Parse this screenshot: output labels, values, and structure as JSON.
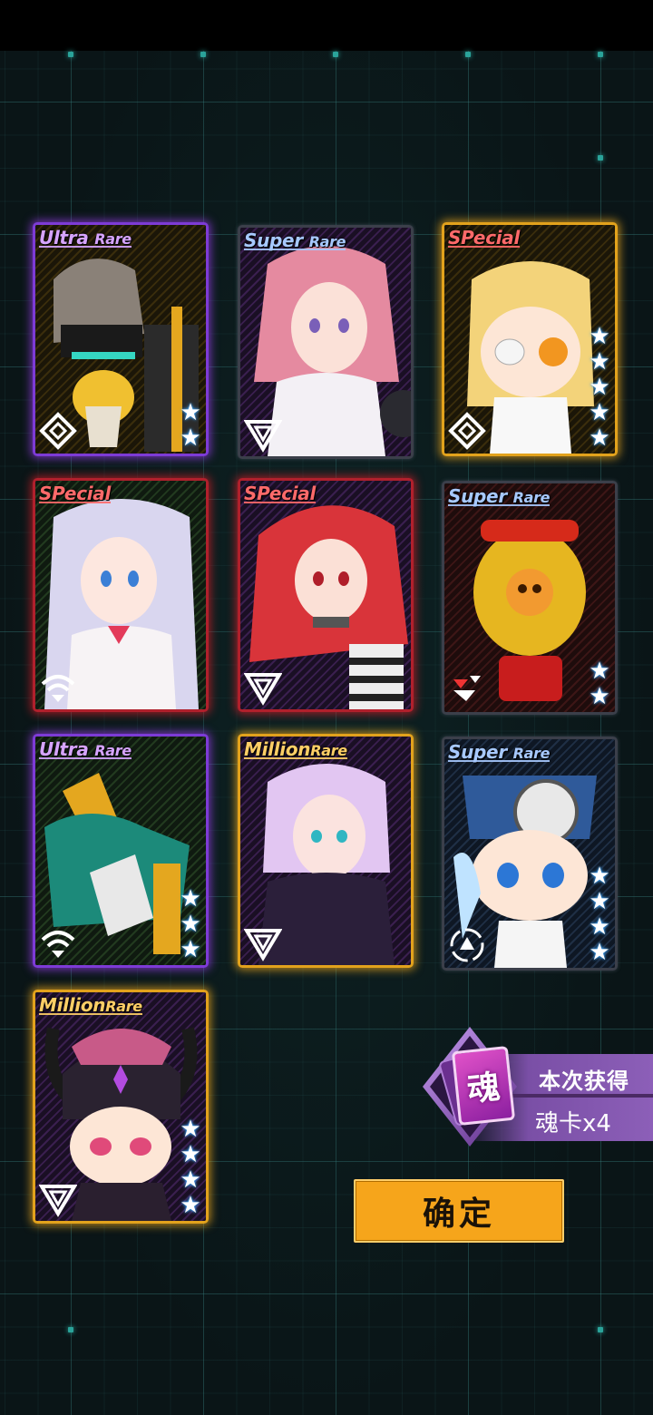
{
  "cards": [
    {
      "rarity_main": "Ultra",
      "rarity_sub": "Rare",
      "tier": "ur",
      "stars": 2,
      "element": "diamond-element-icon",
      "portrait": "mech-operator-chibi"
    },
    {
      "rarity_main": "Super",
      "rarity_sub": "Rare",
      "tier": "sr",
      "stars": 0,
      "element": "triangle-element-icon",
      "portrait": "pink-hair-girl"
    },
    {
      "rarity_main": "SPecial",
      "rarity_sub": "",
      "tier": "spg",
      "stars": 5,
      "element": "diamond-element-icon",
      "portrait": "blonde-eyepatch-chibi"
    },
    {
      "rarity_main": "SPecial",
      "rarity_sub": "",
      "tier": "sp",
      "stars": 0,
      "element": "wifi-element-icon",
      "portrait": "nurse-girl"
    },
    {
      "rarity_main": "SPecial",
      "rarity_sub": "",
      "tier": "sp",
      "stars": 0,
      "element": "triangle-element-icon",
      "portrait": "red-hair-girl"
    },
    {
      "rarity_main": "Super",
      "rarity_sub": "Rare",
      "tier": "sr",
      "stars": 2,
      "element": "slash-element-icon",
      "portrait": "skull-robot"
    },
    {
      "rarity_main": "Ultra",
      "rarity_sub": "Rare",
      "tier": "ur",
      "stars": 3,
      "element": "wifi-element-icon",
      "portrait": "green-mech"
    },
    {
      "rarity_main": "Million",
      "rarity_sub": "Rare",
      "tier": "mr",
      "stars": 0,
      "element": "triangle-element-icon",
      "portrait": "lavender-hair-girl"
    },
    {
      "rarity_main": "Super",
      "rarity_sub": "Rare",
      "tier": "sr",
      "stars": 4,
      "element": "target-element-icon",
      "portrait": "blue-helmet-chibi"
    },
    {
      "rarity_main": "Million",
      "rarity_sub": "Rare",
      "tier": "mr",
      "stars": 4,
      "element": "triangle-element-icon",
      "portrait": "horned-helmet-chibi"
    }
  ],
  "bonus": {
    "title": "本次获得",
    "value": "魂卡x4",
    "icon_glyph": "魂"
  },
  "confirm_label": "确定",
  "colors": {
    "ultra_rare": "#7d3bd6",
    "special": "#b0202c",
    "million_rare": "#e2a21c",
    "super_rare": "#3b3f4a",
    "button": "#f6a51b",
    "star_glow": "#3fa8ff"
  }
}
